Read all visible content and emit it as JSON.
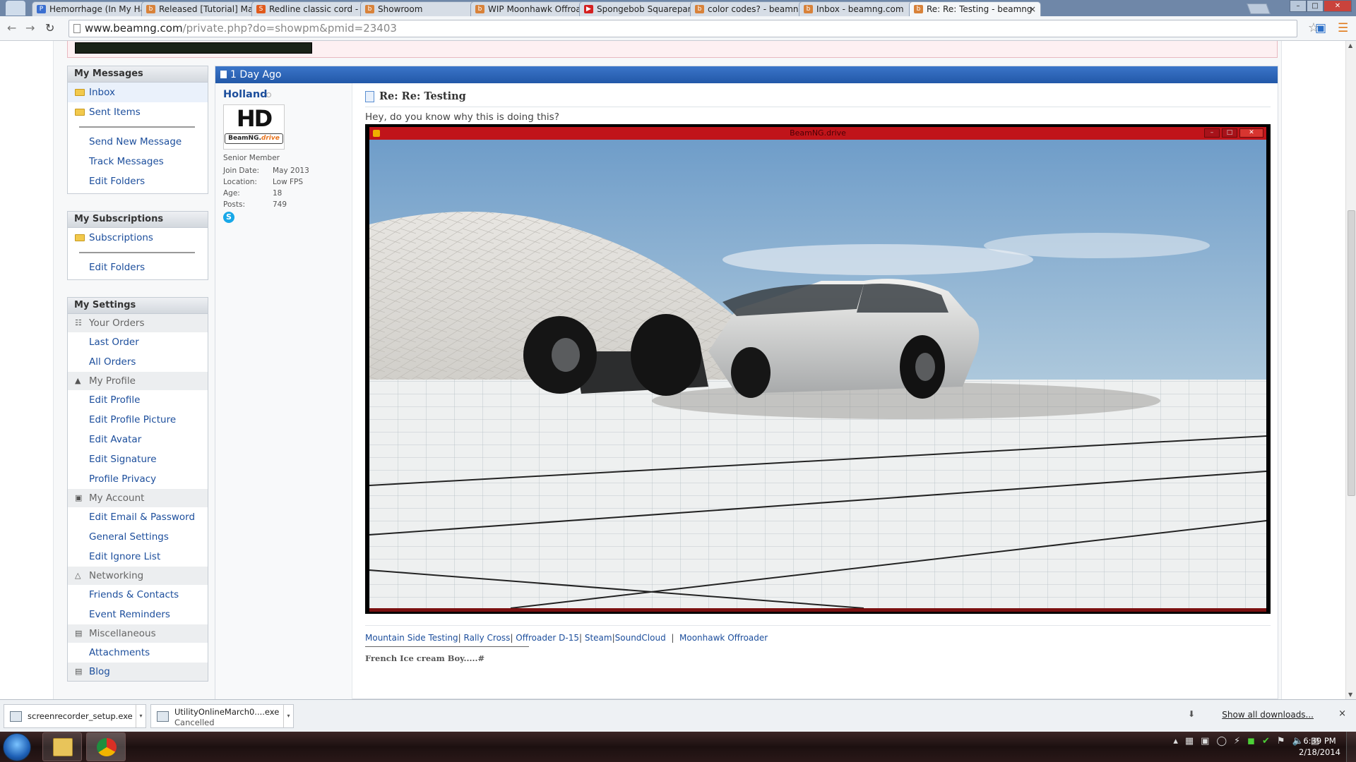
{
  "browser": {
    "tabs": [
      {
        "label": "Hemorrhage (In My Hand",
        "favicon": "P",
        "fav_color": "#3b6fd0"
      },
      {
        "label": "Released [Tutorial] Makin",
        "favicon": "b",
        "fav_color": "#d8823a"
      },
      {
        "label": "Redline classic cord - Priv",
        "favicon": "S",
        "fav_color": "#e05a1c"
      },
      {
        "label": "Showroom",
        "favicon": "b",
        "fav_color": "#d8823a"
      },
      {
        "label": "WIP Moonhawk Offroade",
        "favicon": "b",
        "fav_color": "#d8823a"
      },
      {
        "label": "Spongebob Squarepants",
        "favicon": "▶",
        "fav_color": "#d42020"
      },
      {
        "label": "color codes? - beamng.c",
        "favicon": "b",
        "fav_color": "#d8823a"
      },
      {
        "label": "Inbox - beamng.com",
        "favicon": "b",
        "fav_color": "#d8823a"
      },
      {
        "label": "Re: Re: Testing - beamng",
        "favicon": "b",
        "fav_color": "#d8823a",
        "active": true
      }
    ],
    "tab_close": "×",
    "url_host": "www.beamng.com",
    "url_path": "/private.php?do=showpm&pmid=23403"
  },
  "sidebar": {
    "messages": {
      "title": "My Messages",
      "folders": [
        "Inbox",
        "Sent Items"
      ],
      "links": [
        "Send New Message",
        "Track Messages",
        "Edit Folders"
      ]
    },
    "subscriptions": {
      "title": "My Subscriptions",
      "folder": "Subscriptions",
      "links": [
        "Edit Folders"
      ]
    },
    "settings": {
      "title": "My Settings",
      "groups": [
        {
          "label": "Your Orders",
          "icon": "orders-icon",
          "items": [
            "Last Order",
            "All Orders"
          ]
        },
        {
          "label": "My Profile",
          "icon": "user-icon",
          "items": [
            "Edit Profile",
            "Edit Profile Picture",
            "Edit Avatar",
            "Edit Signature",
            "Profile Privacy"
          ]
        },
        {
          "label": "My Account",
          "icon": "lock-icon",
          "items": [
            "Edit Email & Password",
            "General Settings",
            "Edit Ignore List"
          ]
        },
        {
          "label": "Networking",
          "icon": "people-icon",
          "items": [
            "Friends & Contacts",
            "Event Reminders"
          ]
        },
        {
          "label": "Miscellaneous",
          "icon": "misc-icon",
          "items": [
            "Attachments"
          ]
        }
      ],
      "blog": "Blog"
    }
  },
  "post": {
    "date": "1 Day Ago",
    "username": "Holland",
    "avatar_text": "HD",
    "avatar_brand": "BeamNG.",
    "avatar_brand_accent": "drive",
    "user_title": "Senior Member",
    "fields": [
      {
        "k": "Join Date:",
        "v": "May 2013"
      },
      {
        "k": "Location:",
        "v": "Low FPS"
      },
      {
        "k": "Age:",
        "v": "18"
      },
      {
        "k": "Posts:",
        "v": "749"
      }
    ],
    "title": "Re: Re: Testing",
    "message": "Hey, do you know why this is doing this?",
    "screenshot_window_title": "BeamNG.drive",
    "signature_links": [
      "Mountain Side Testing",
      "Rally Cross",
      "Offroader D-15",
      "Steam",
      "SoundCloud",
      "Moonhawk Offroader"
    ],
    "signature_text": "French Ice cream Boy.....#"
  },
  "downloads": {
    "items": [
      {
        "name": "screenrecorder_setup.exe",
        "status": ""
      },
      {
        "name": "UtilityOnlineMarch0....exe",
        "status": "Cancelled"
      }
    ],
    "show_all": "Show all downloads...",
    "close": "×"
  },
  "taskbar": {
    "time": "6:39 PM",
    "date": "2/18/2014"
  }
}
